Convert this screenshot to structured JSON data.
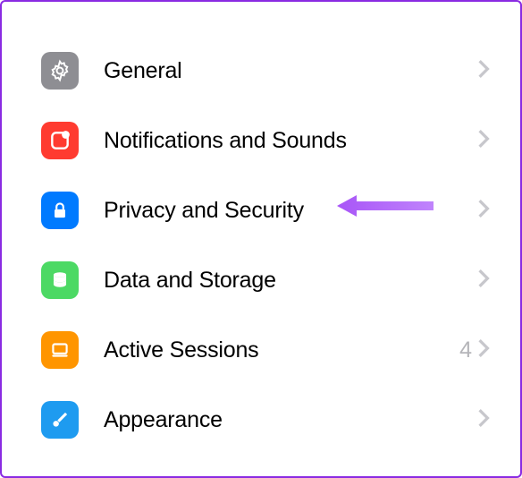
{
  "settings": {
    "items": [
      {
        "label": "General",
        "icon": "gear-icon",
        "bg": "bg-gray",
        "value": ""
      },
      {
        "label": "Notifications and Sounds",
        "icon": "bell-badge-icon",
        "bg": "bg-red",
        "value": ""
      },
      {
        "label": "Privacy and Security",
        "icon": "lock-icon",
        "bg": "bg-blue",
        "value": ""
      },
      {
        "label": "Data and Storage",
        "icon": "database-icon",
        "bg": "bg-green",
        "value": ""
      },
      {
        "label": "Active Sessions",
        "icon": "laptop-icon",
        "bg": "bg-orange",
        "value": "4"
      },
      {
        "label": "Appearance",
        "icon": "brush-icon",
        "bg": "bg-blue2",
        "value": ""
      }
    ]
  },
  "annotation": {
    "color": "#a855f7",
    "target_index": 2
  }
}
